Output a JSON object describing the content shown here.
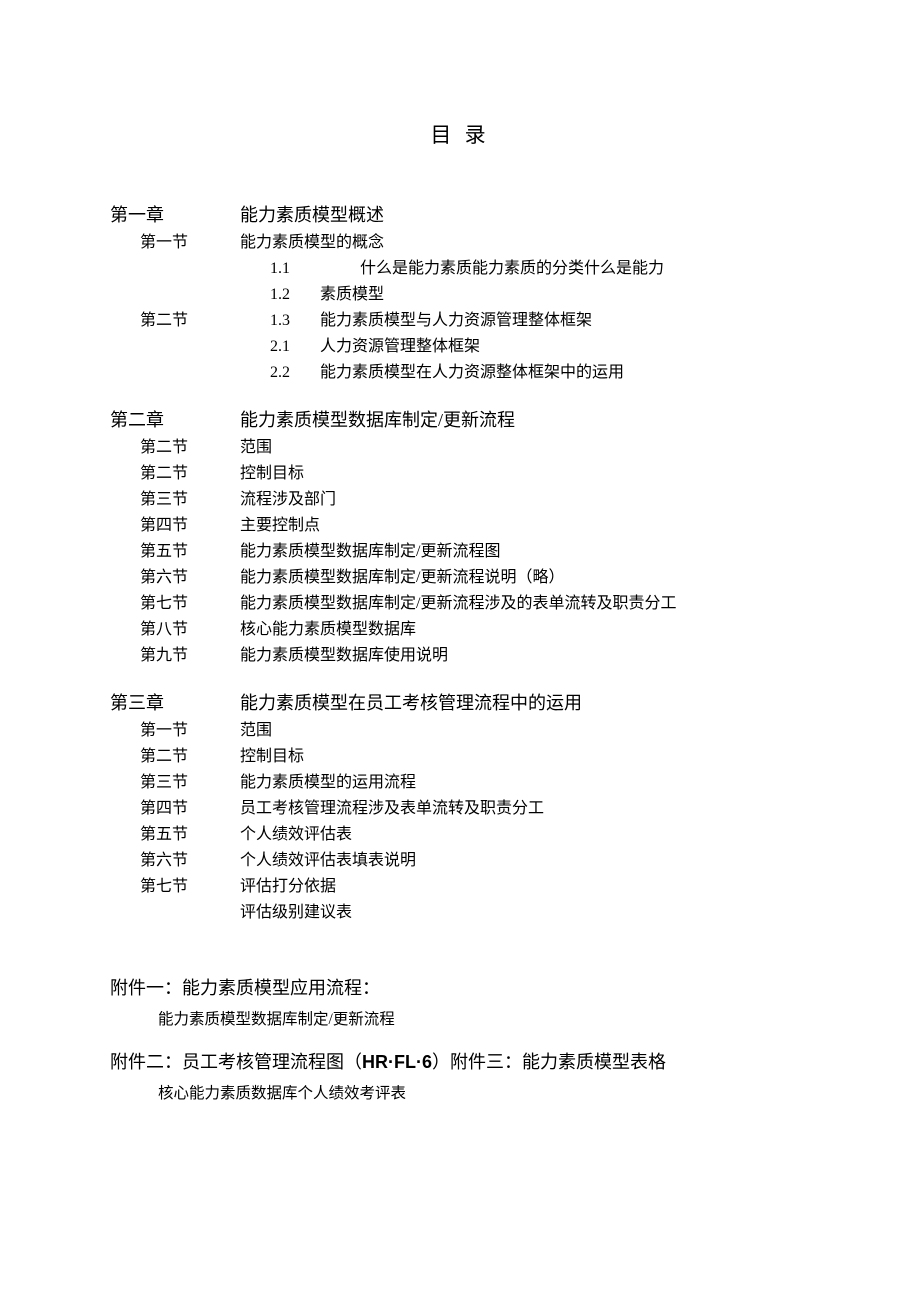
{
  "title": "目 录",
  "chapters": [
    {
      "label": "第一章",
      "text": "能力素质模型概述",
      "sections": [
        {
          "label": "第一节",
          "text": "能力素质模型的概念"
        }
      ],
      "numbered": [
        {
          "n": "1.1",
          "text": "什么是能力素质能力素质的分类什么是能力",
          "far": true
        },
        {
          "n": "1.2",
          "text": "素质模型"
        }
      ],
      "split_section": {
        "label": "第二节",
        "n": "1.3",
        "text": "能力素质模型与人力资源管理整体框架"
      },
      "numbered_after": [
        {
          "n": "2.1",
          "text": "人力资源管理整体框架"
        },
        {
          "n": "2.2",
          "text": "能力素质模型在人力资源整体框架中的运用"
        }
      ]
    },
    {
      "label": "第二章",
      "text": "能力素质模型数据库制定/更新流程",
      "sections": [
        {
          "label": "第二节",
          "text": "范围"
        },
        {
          "label": "第二节",
          "text": "控制目标"
        },
        {
          "label": "第三节",
          "text": "流程涉及部门"
        },
        {
          "label": "第四节",
          "text": "主要控制点"
        },
        {
          "label": "第五节",
          "text": "能力素质模型数据库制定/更新流程图"
        },
        {
          "label": "第六节",
          "text": "能力素质模型数据库制定/更新流程说明（略）"
        },
        {
          "label": "第七节",
          "text": "能力素质模型数据库制定/更新流程涉及的表单流转及职责分工"
        },
        {
          "label": "第八节",
          "text": "核心能力素质模型数据库"
        },
        {
          "label": "第九节",
          "text": "能力素质模型数据库使用说明"
        }
      ]
    },
    {
      "label": "第三章",
      "text": "能力素质模型在员工考核管理流程中的运用",
      "sections": [
        {
          "label": "第一节",
          "text": "范围"
        },
        {
          "label": "第二节",
          "text": "控制目标"
        },
        {
          "label": "第三节",
          "text": "能力素质模型的运用流程"
        },
        {
          "label": "第四节",
          "text": "员工考核管理流程涉及表单流转及职责分工"
        },
        {
          "label": "第五节",
          "text": "个人绩效评估表"
        },
        {
          "label": "第六节",
          "text": "个人绩效评估表填表说明"
        },
        {
          "label": "第七节",
          "text": "评估打分依据"
        },
        {
          "label": "",
          "text": "评估级别建议表"
        }
      ]
    }
  ],
  "attachment1": {
    "line": "附件一：能力素质模型应用流程：",
    "sub": "能力素质模型数据库制定/更新流程"
  },
  "attachment2": {
    "pre": "附件二：员工考核管理流程图（",
    "bold": "HR·FL·6",
    "post": "）附件三：能力素质模型表格",
    "sub": "核心能力素质数据库个人绩效考评表"
  }
}
